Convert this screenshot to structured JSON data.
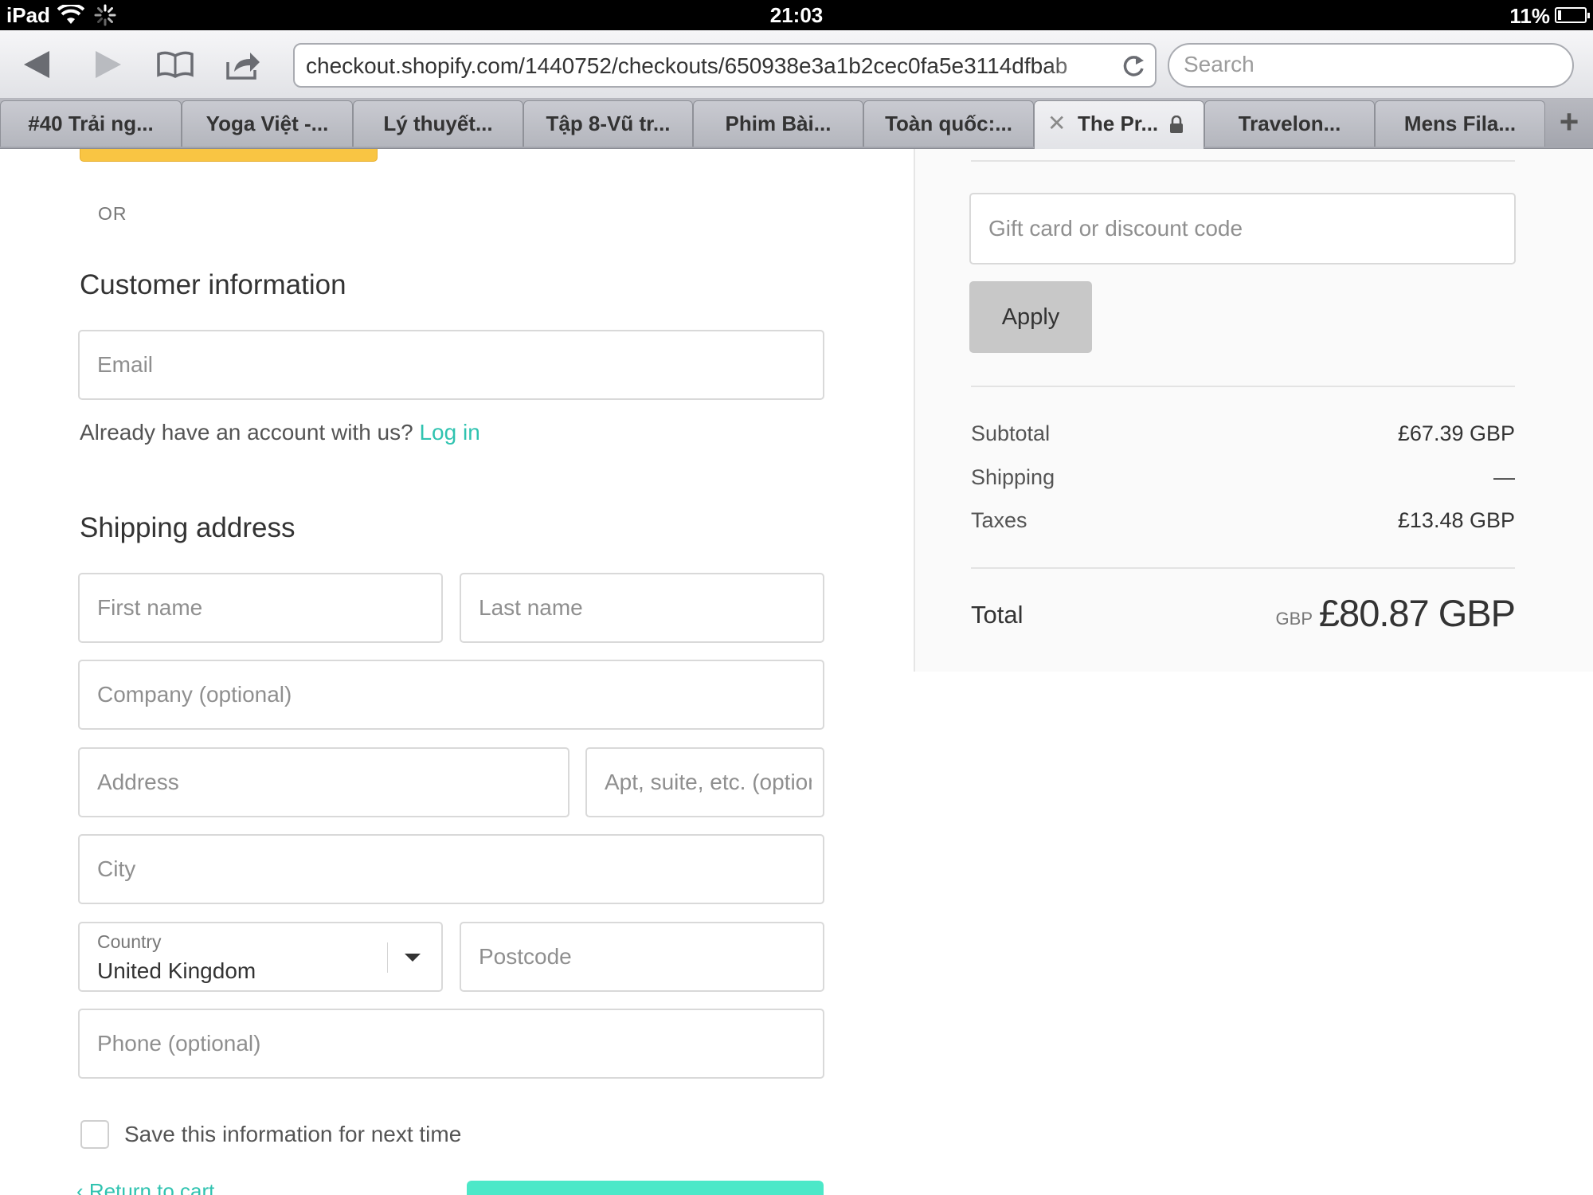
{
  "status_bar": {
    "device": "iPad",
    "time": "21:03",
    "battery_pct": "11%",
    "battery_level": 0.11
  },
  "browser": {
    "url": "checkout.shopify.com/1440752/checkouts/650938e3a1b2cec0fa5e3114dfbab",
    "search_placeholder": "Search",
    "tabs": [
      {
        "label": "#40 Trải ng..."
      },
      {
        "label": "Yoga Việt -..."
      },
      {
        "label": "Lý thuyết..."
      },
      {
        "label": "Tập 8-Vũ tr..."
      },
      {
        "label": "Phim Bài..."
      },
      {
        "label": "Toàn quốc:..."
      },
      {
        "label": "The Pr...",
        "active": true
      },
      {
        "label": "Travelon..."
      },
      {
        "label": "Mens Fila..."
      }
    ],
    "new_tab": "+",
    "close_tab": "✕"
  },
  "checkout": {
    "or_text": "OR",
    "customer_info": {
      "title": "Customer information",
      "email_placeholder": "Email",
      "account_prompt": "Already have an account with us?",
      "login_link": "Log in"
    },
    "shipping": {
      "title": "Shipping address",
      "first_name_placeholder": "First name",
      "last_name_placeholder": "Last name",
      "company_placeholder": "Company (optional)",
      "address_placeholder": "Address",
      "apt_placeholder": "Apt, suite, etc. (optional)",
      "city_placeholder": "City",
      "country_label": "Country",
      "country_value": "United Kingdom",
      "postcode_placeholder": "Postcode",
      "phone_placeholder": "Phone (optional)"
    },
    "save_info_label": "Save this information for next time",
    "return_link": "‹ Return to cart"
  },
  "summary": {
    "discount_placeholder": "Gift card or discount code",
    "apply_label": "Apply",
    "subtotal_label": "Subtotal",
    "subtotal_value": "£67.39 GBP",
    "shipping_label": "Shipping",
    "shipping_value": "—",
    "taxes_label": "Taxes",
    "taxes_value": "£13.48 GBP",
    "total_label": "Total",
    "total_currency": "GBP",
    "total_value": "£80.87 GBP"
  },
  "colors": {
    "accent": "#30c3b0",
    "continue_button": "#4ce8c8",
    "express_button": "#f9c543"
  }
}
